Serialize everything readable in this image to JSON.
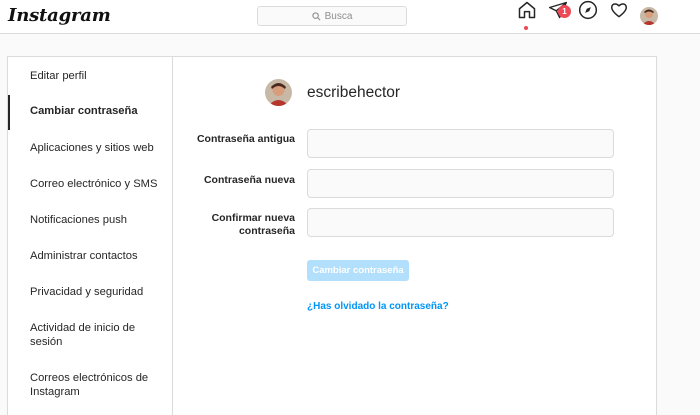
{
  "nav": {
    "logo": "Instagram",
    "search_placeholder": "Busca",
    "direct_badge": "1",
    "accent_color": "#ed4956",
    "icons": [
      "home-icon",
      "direct-icon",
      "explore-icon",
      "heart-icon",
      "avatar"
    ]
  },
  "sidebar": {
    "items": [
      {
        "label": "Editar perfil"
      },
      {
        "label": "Cambiar contraseña",
        "active": true
      },
      {
        "label": "Aplicaciones y sitios web"
      },
      {
        "label": "Correo electrónico y SMS"
      },
      {
        "label": "Notificaciones push"
      },
      {
        "label": "Administrar contactos"
      },
      {
        "label": "Privacidad y seguridad"
      },
      {
        "label": "Actividad de inicio de sesión"
      },
      {
        "label": "Correos electrónicos de Instagram"
      }
    ]
  },
  "profile": {
    "username": "escribehector"
  },
  "form": {
    "old_password_label": "Contraseña antigua",
    "new_password_label": "Contraseña nueva",
    "confirm_password_label": "Confirmar nueva contraseña",
    "old_password_value": "",
    "new_password_value": "",
    "confirm_password_value": "",
    "submit_label": "Cambiar contraseña",
    "forgot_link": "¿Has olvidado la contraseña?",
    "submit_color": "#b2dffc",
    "link_color": "#0095f6"
  }
}
